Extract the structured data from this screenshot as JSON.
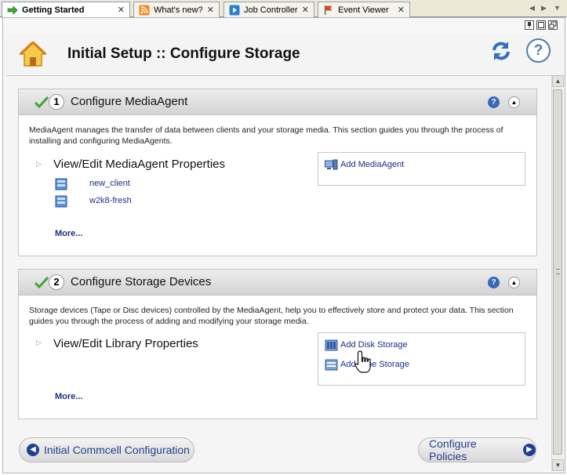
{
  "tabs": [
    {
      "label": "Getting Started",
      "icon": "green-arrow-icon",
      "active": true
    },
    {
      "label": "What's new?",
      "icon": "rss-icon",
      "active": false
    },
    {
      "label": "Job Controller",
      "icon": "play-icon",
      "active": false
    },
    {
      "label": "Event Viewer",
      "icon": "flag-icon",
      "active": false
    }
  ],
  "tab_close_glyph": "✕",
  "header": {
    "title": "Initial Setup :: Configure Storage",
    "help_glyph": "?"
  },
  "sections": [
    {
      "step": "1",
      "title": "Configure MediaAgent",
      "description": "MediaAgent manages the transfer of data between clients and your storage media. This section guides you through the process of installing and configuring MediaAgents.",
      "subsection_title": "View/Edit MediaAgent Properties",
      "actions": [
        {
          "label": "Add MediaAgent",
          "icon": "media-agent-icon"
        }
      ],
      "items": [
        "new_client",
        "w2k8-fresh"
      ],
      "more": "More..."
    },
    {
      "step": "2",
      "title": "Configure Storage Devices",
      "description": "Storage devices (Tape or Disc devices) controlled by the MediaAgent, help you to effectively store and protect your data. This section guides you through the process of adding and modifying your storage media.",
      "subsection_title": "View/Edit Library Properties",
      "actions": [
        {
          "label": "Add Disk Storage",
          "icon": "disk-library-icon"
        },
        {
          "label": "Add Tape Storage",
          "icon": "tape-library-icon"
        }
      ],
      "more": "More..."
    }
  ],
  "footer": {
    "back_label": "Initial Commcell Configuration",
    "next_label": "Configure Policies"
  },
  "colors": {
    "link": "#1b2f8a",
    "accent": "#3b67b8"
  }
}
